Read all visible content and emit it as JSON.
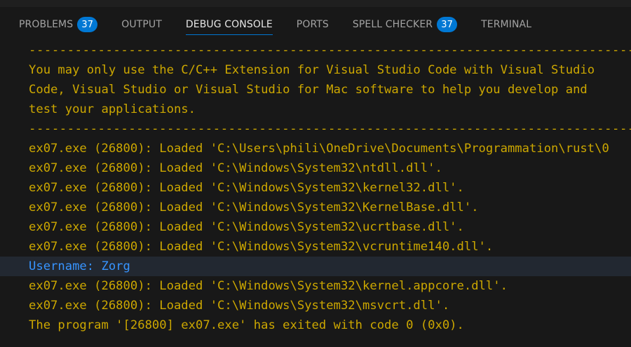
{
  "tabs": [
    {
      "label": "PROBLEMS",
      "badge": "37",
      "active": false
    },
    {
      "label": "OUTPUT",
      "badge": null,
      "active": false
    },
    {
      "label": "DEBUG CONSOLE",
      "badge": null,
      "active": true
    },
    {
      "label": "PORTS",
      "badge": null,
      "active": false
    },
    {
      "label": "SPELL CHECKER",
      "badge": "37",
      "active": false
    },
    {
      "label": "TERMINAL",
      "badge": null,
      "active": false
    }
  ],
  "console": {
    "lines": [
      "-------------------------------------------------------------------------------",
      "You may only use the C/C++ Extension for Visual Studio Code with Visual Studio",
      "Code, Visual Studio or Visual Studio for Mac software to help you develop and",
      "test your applications.",
      "-------------------------------------------------------------------------------",
      "ex07.exe (26800): Loaded 'C:\\Users\\phili\\OneDrive\\Documents\\Programmation\\rust\\0",
      "ex07.exe (26800): Loaded 'C:\\Windows\\System32\\ntdll.dll'.",
      "ex07.exe (26800): Loaded 'C:\\Windows\\System32\\kernel32.dll'.",
      "ex07.exe (26800): Loaded 'C:\\Windows\\System32\\KernelBase.dll'.",
      "ex07.exe (26800): Loaded 'C:\\Windows\\System32\\ucrtbase.dll'.",
      "ex07.exe (26800): Loaded 'C:\\Windows\\System32\\vcruntime140.dll'.",
      "Username: Zorg",
      "ex07.exe (26800): Loaded 'C:\\Windows\\System32\\kernel.appcore.dll'.",
      "ex07.exe (26800): Loaded 'C:\\Windows\\System32\\msvcrt.dll'.",
      "The program '[26800] ex07.exe' has exited with code 0 (0x0)."
    ]
  },
  "colors": {
    "output_text": "#cca700",
    "user_input": "#3794ff",
    "accent": "#0078d4",
    "background": "#181818"
  }
}
